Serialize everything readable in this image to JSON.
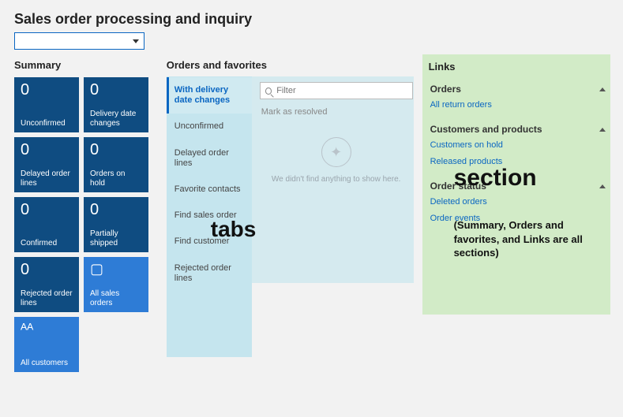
{
  "page_title": "Sales order processing and inquiry",
  "top_select_value": "",
  "summary": {
    "header": "Summary",
    "tiles": [
      {
        "count": "0",
        "label": "Unconfirmed"
      },
      {
        "count": "0",
        "label": "Delivery date changes"
      },
      {
        "count": "0",
        "label": "Delayed order lines"
      },
      {
        "count": "0",
        "label": "Orders on hold"
      },
      {
        "count": "0",
        "label": "Confirmed"
      },
      {
        "count": "0",
        "label": "Partially shipped"
      },
      {
        "count": "0",
        "label": "Rejected order lines"
      },
      {
        "glyph": "▢",
        "label": "All sales orders",
        "bright": true
      },
      {
        "glyph": "ᴬᴬ",
        "label": "All customers",
        "bright": true
      }
    ]
  },
  "orders": {
    "header": "Orders and favorites",
    "tabs": [
      "With delivery date changes",
      "Unconfirmed",
      "Delayed order lines",
      "Favorite contacts",
      "Find sales order",
      "Find customer",
      "Rejected order lines"
    ],
    "filter_placeholder": "Filter",
    "mark_resolved": "Mark as resolved",
    "empty_message": "We didn't find anything to show here.",
    "overlay_label": "tabs"
  },
  "links": {
    "header": "Links",
    "groups": [
      {
        "title": "Orders",
        "items": [
          "All return orders"
        ]
      },
      {
        "title": "Customers and products",
        "items": [
          "Customers on hold",
          "Released products"
        ]
      },
      {
        "title": "Order status",
        "items": [
          "Deleted orders",
          "Order events"
        ]
      }
    ],
    "overlay_title": "section",
    "overlay_sub": "(Summary, Orders and favorites, and Links are all sections)"
  }
}
